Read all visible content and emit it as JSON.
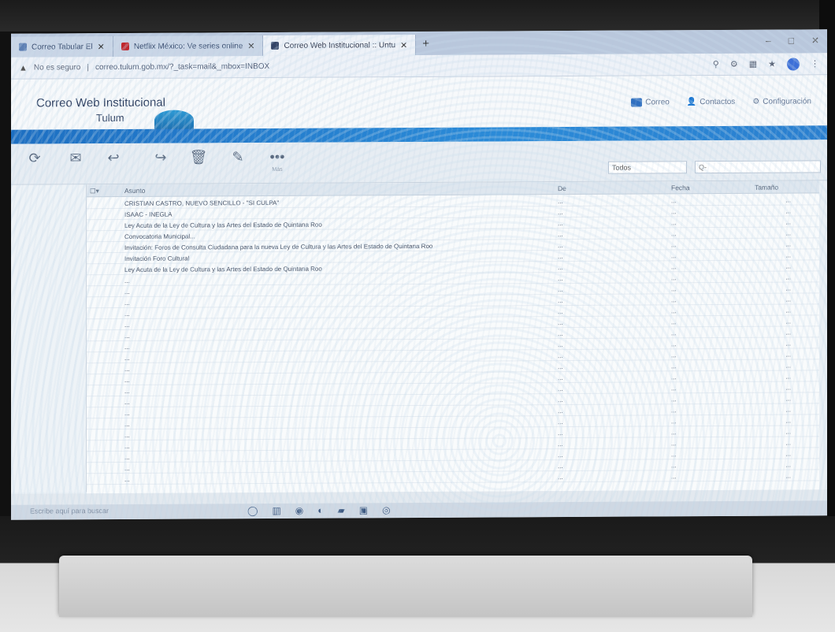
{
  "browser": {
    "tabs": [
      {
        "label": "Correo Tabular El",
        "active": false
      },
      {
        "label": "Netflix México: Ve series online",
        "active": false
      },
      {
        "label": "Correo Web Institucional :: Untu",
        "active": true
      }
    ],
    "new_tab": "+",
    "security_label": "No es seguro",
    "url": "correo.tulum.gob.mx/?_task=mail&_mbox=INBOX"
  },
  "app": {
    "title": "Correo Web Institucional",
    "subtitle": "Tulum",
    "nav": [
      {
        "label": "Correo",
        "icon": "mail-icon"
      },
      {
        "label": "Contactos",
        "icon": "contacts-icon"
      },
      {
        "label": "Configuración",
        "icon": "gear-icon"
      }
    ]
  },
  "toolbar": {
    "buttons": [
      {
        "icon": "refresh-icon",
        "label": ""
      },
      {
        "icon": "compose-icon",
        "label": ""
      },
      {
        "icon": "reply-icon",
        "label": ""
      },
      {
        "icon": "delete-icon",
        "label": ""
      },
      {
        "icon": "mark-icon",
        "label": ""
      },
      {
        "icon": "more-icon",
        "label": "Más"
      }
    ],
    "filter_value": "Todos",
    "search_placeholder": "Q-"
  },
  "list": {
    "headers": {
      "subject": "Asunto",
      "from": "De",
      "date": "Fecha",
      "size": "Tamaño"
    },
    "rows": [
      {
        "subject": "CRISTIAN CASTRO, NUEVO SENCILLO - \"SI CULPA\"",
        "from": "...",
        "date": "...",
        "size": "...",
        "flag": ""
      },
      {
        "subject": "ISAAC - INEGLA",
        "from": "...",
        "date": "...",
        "size": "...",
        "flag": ""
      },
      {
        "subject": "Ley Acuta de la Ley de Cultura y las Artes del Estado de Quintana Roo",
        "from": "...",
        "date": "...",
        "size": "...",
        "flag": ""
      },
      {
        "subject": "Convocatoria Municipal...",
        "from": "...",
        "date": "...",
        "size": "...",
        "flag": ""
      },
      {
        "subject": "Invitación: Foros de Consulta Ciudadana para la nueva Ley de Cultura y las Artes del Estado de Quintana Roo",
        "from": "...",
        "date": "...",
        "size": "...",
        "flag": ""
      },
      {
        "subject": "Invitación Foro Cultural",
        "from": "...",
        "date": "...",
        "size": "...",
        "flag": ""
      },
      {
        "subject": "Ley Acuta de la Ley de Cultura y las Artes del Estado de Quintana Roo",
        "from": "...",
        "date": "...",
        "size": "...",
        "flag": ""
      },
      {
        "subject": "...",
        "from": "...",
        "date": "...",
        "size": "...",
        "flag": ""
      },
      {
        "subject": "...",
        "from": "...",
        "date": "...",
        "size": "...",
        "flag": ""
      },
      {
        "subject": "...",
        "from": "...",
        "date": "...",
        "size": "...",
        "flag": ""
      },
      {
        "subject": "...",
        "from": "...",
        "date": "...",
        "size": "...",
        "flag": ""
      },
      {
        "subject": "...",
        "from": "...",
        "date": "...",
        "size": "...",
        "flag": ""
      },
      {
        "subject": "...",
        "from": "...",
        "date": "...",
        "size": "...",
        "flag": ""
      },
      {
        "subject": "...",
        "from": "...",
        "date": "...",
        "size": "...",
        "flag": ""
      },
      {
        "subject": "...",
        "from": "...",
        "date": "...",
        "size": "...",
        "flag": ""
      },
      {
        "subject": "...",
        "from": "...",
        "date": "...",
        "size": "...",
        "flag": ""
      },
      {
        "subject": "...",
        "from": "...",
        "date": "...",
        "size": "...",
        "flag": ""
      },
      {
        "subject": "...",
        "from": "...",
        "date": "...",
        "size": "...",
        "flag": ""
      },
      {
        "subject": "...",
        "from": "...",
        "date": "...",
        "size": "...",
        "flag": ""
      },
      {
        "subject": "...",
        "from": "...",
        "date": "...",
        "size": "...",
        "flag": ""
      },
      {
        "subject": "...",
        "from": "...",
        "date": "...",
        "size": "...",
        "flag": ""
      },
      {
        "subject": "...",
        "from": "...",
        "date": "...",
        "size": "...",
        "flag": ""
      },
      {
        "subject": "...",
        "from": "...",
        "date": "...",
        "size": "...",
        "flag": ""
      },
      {
        "subject": "...",
        "from": "...",
        "date": "...",
        "size": "...",
        "flag": ""
      },
      {
        "subject": "...",
        "from": "...",
        "date": "...",
        "size": "...",
        "flag": ""
      },
      {
        "subject": "...",
        "from": "...",
        "date": "...",
        "size": "...",
        "flag": ""
      }
    ]
  },
  "taskbar": {
    "search_placeholder": "Escribe aquí para buscar"
  },
  "colors": {
    "accent": "#1d6fc2",
    "page_bg": "#eaf0f5"
  }
}
